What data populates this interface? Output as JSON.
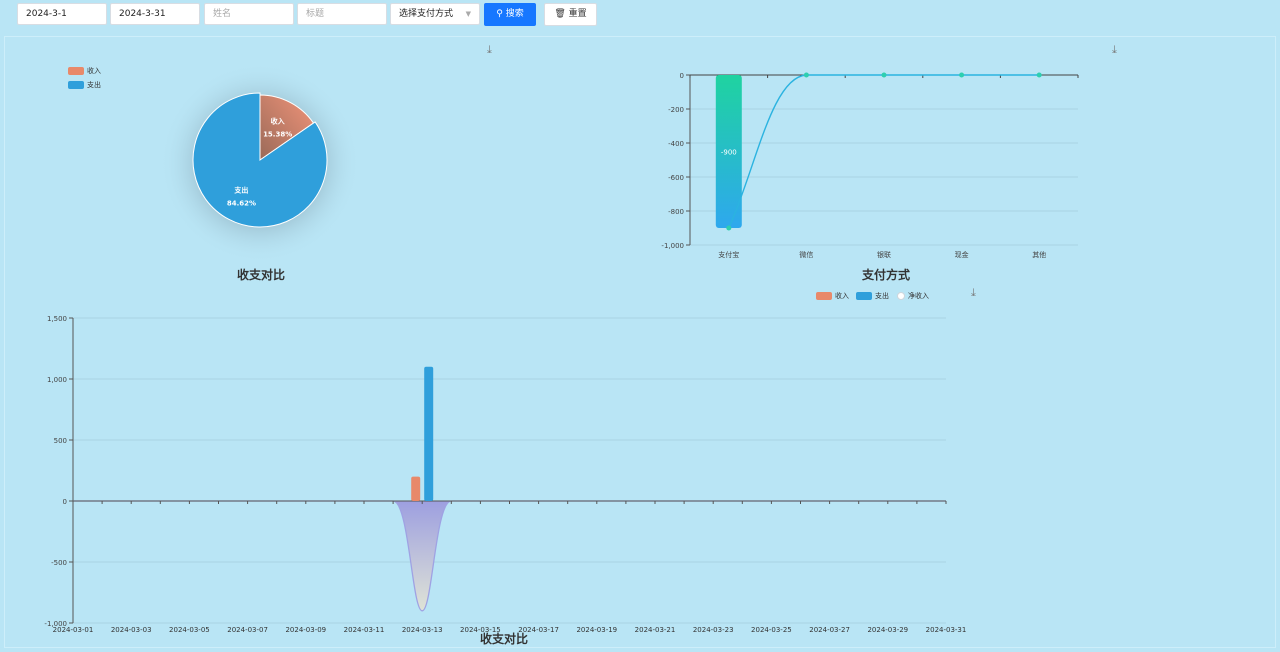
{
  "filters": {
    "start_date": "2024-3-1",
    "end_date": "2024-3-31",
    "name_placeholder": "姓名",
    "title_placeholder": "标题",
    "payment_select": "选择支付方式",
    "search_label": "搜索",
    "reset_label": "重置"
  },
  "colors": {
    "income": "#e8896a",
    "expense": "#2f9fdb",
    "net": "#2ecfb0",
    "search_button": "#1677ff"
  },
  "icons": [
    "download-icon",
    "search-icon",
    "trash-icon",
    "chevron-down-icon"
  ],
  "chart_data": [
    {
      "type": "pie",
      "title": "收支对比",
      "legend": [
        "收入",
        "支出"
      ],
      "legend_position": "top-left",
      "slices": [
        {
          "name": "收入",
          "value": 15.38,
          "label": "15.38%"
        },
        {
          "name": "支出",
          "value": 84.62,
          "label": "84.62%"
        }
      ]
    },
    {
      "type": "bar",
      "title": "支付方式",
      "categories": [
        "支付宝",
        "微信",
        "银联",
        "现金",
        "其他"
      ],
      "values": [
        -900,
        0,
        0,
        0,
        0
      ],
      "data_labels": [
        "-900"
      ],
      "line_values": [
        -900,
        0,
        0,
        0,
        0
      ],
      "y_ticks": [
        "0",
        "-200",
        "-400",
        "-600",
        "-800",
        "-1,000"
      ],
      "ylim": [
        -1000,
        0
      ],
      "grid": true
    },
    {
      "type": "bar",
      "title": "收支对比",
      "legend": [
        "收入",
        "支出",
        "净收入"
      ],
      "legend_position": "top-center",
      "x": [
        "2024-03-01",
        "2024-03-02",
        "2024-03-03",
        "2024-03-04",
        "2024-03-05",
        "2024-03-06",
        "2024-03-07",
        "2024-03-08",
        "2024-03-09",
        "2024-03-10",
        "2024-03-11",
        "2024-03-12",
        "2024-03-13",
        "2024-03-14",
        "2024-03-15",
        "2024-03-16",
        "2024-03-17",
        "2024-03-18",
        "2024-03-19",
        "2024-03-20",
        "2024-03-21",
        "2024-03-22",
        "2024-03-23",
        "2024-03-24",
        "2024-03-25",
        "2024-03-26",
        "2024-03-27",
        "2024-03-28",
        "2024-03-29",
        "2024-03-30",
        "2024-03-31"
      ],
      "x_tick_labels": [
        "2024-03-01",
        "2024-03-03",
        "2024-03-05",
        "2024-03-07",
        "2024-03-09",
        "2024-03-11",
        "2024-03-13",
        "2024-03-15",
        "2024-03-17",
        "2024-03-19",
        "2024-03-21",
        "2024-03-23",
        "2024-03-25",
        "2024-03-27",
        "2024-03-29",
        "2024-03-31"
      ],
      "series": [
        {
          "name": "收入",
          "values": [
            0,
            0,
            0,
            0,
            0,
            0,
            0,
            0,
            0,
            0,
            0,
            0,
            200,
            0,
            0,
            0,
            0,
            0,
            0,
            0,
            0,
            0,
            0,
            0,
            0,
            0,
            0,
            0,
            0,
            0,
            0
          ]
        },
        {
          "name": "支出",
          "values": [
            0,
            0,
            0,
            0,
            0,
            0,
            0,
            0,
            0,
            0,
            0,
            0,
            1100,
            0,
            0,
            0,
            0,
            0,
            0,
            0,
            0,
            0,
            0,
            0,
            0,
            0,
            0,
            0,
            0,
            0,
            0
          ]
        },
        {
          "name": "净收入",
          "values": [
            0,
            0,
            0,
            0,
            0,
            0,
            0,
            0,
            0,
            0,
            0,
            0,
            -900,
            0,
            0,
            0,
            0,
            0,
            0,
            0,
            0,
            0,
            0,
            0,
            0,
            0,
            0,
            0,
            0,
            0,
            0
          ]
        }
      ],
      "y_ticks": [
        "1,500",
        "1,000",
        "500",
        "0",
        "-500",
        "-1,000"
      ],
      "ylim": [
        -1000,
        1500
      ],
      "grid": true
    }
  ]
}
